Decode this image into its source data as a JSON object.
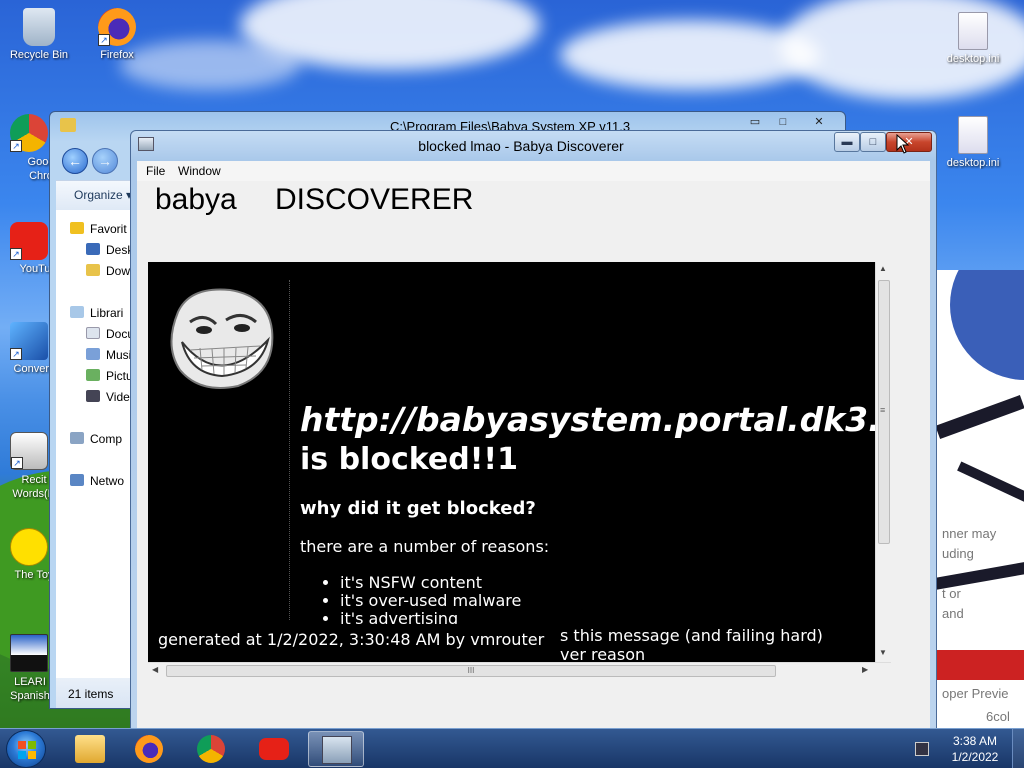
{
  "desktop": {
    "icons_left": [
      {
        "label": "Recycle Bin",
        "icon": "recycle-bin-icon"
      },
      {
        "label": "Firefox",
        "icon": "firefox-icon"
      },
      {
        "label": "Goog Chro",
        "icon": "chrome-icon"
      },
      {
        "label": "YouTu",
        "icon": "youtube-icon"
      },
      {
        "label": "Convers",
        "icon": "converter-icon"
      },
      {
        "label": "Recit Words(R",
        "icon": "recite-words-icon"
      },
      {
        "label": "The Toy",
        "icon": "smiley-icon"
      },
      {
        "label": "LEARI Spanish",
        "icon": "learn-spanish-icon"
      }
    ],
    "icons_right": [
      {
        "label": "desktop.ini",
        "icon": "ini-file-icon"
      },
      {
        "label": "desktop.ini",
        "icon": "ini-file-icon"
      }
    ],
    "faded_texts": [
      "nner may",
      "uding",
      "t or",
      "and",
      "oper Previe",
      "6col"
    ]
  },
  "explorer": {
    "title": "C:\\Program Files\\Babya System XP v11.3",
    "organize": "Organize ▾",
    "nav": [
      {
        "label": "Favorit",
        "icon": "star-icon"
      },
      {
        "label": "Desk",
        "icon": "desktop-folder-icon"
      },
      {
        "label": "Dow",
        "icon": "downloads-icon"
      },
      {
        "label": "Librari",
        "icon": "library-icon"
      },
      {
        "label": "Docu",
        "icon": "documents-icon"
      },
      {
        "label": "Musi",
        "icon": "music-icon"
      },
      {
        "label": "Pictu",
        "icon": "pictures-icon"
      },
      {
        "label": "Vide",
        "icon": "videos-icon"
      },
      {
        "label": "Comp",
        "icon": "computer-icon"
      },
      {
        "label": "Netwo",
        "icon": "network-icon"
      }
    ],
    "status": "21 items",
    "minimize": "▭",
    "maximize": "□",
    "close": "✕"
  },
  "discoverer": {
    "title": "blocked lmao - Babya Discoverer",
    "menu": {
      "file": "File",
      "window": "Window"
    },
    "brand_left": "babya",
    "brand_right": "DISCOVERER",
    "controls": {
      "minimize": "▬",
      "maximize": "□",
      "close": "✕"
    },
    "page": {
      "blocked_url": "http://babyasystem.portal.dk3.",
      "blocked_suffix": "is blocked!!1",
      "heading": "why did it get blocked?",
      "intro": "there are a number of reasons:",
      "reasons": [
        "it's NSFW content",
        "it's over-used malware",
        "it's advertising"
      ],
      "generated": "generated at 1/2/2022, 3:30:48 AM by vmrouter",
      "partial_line_1": "s this message (and failing hard)",
      "partial_line_2": "ver reason"
    },
    "hscroll_grip": "III",
    "vscroll_grip": "≡"
  },
  "taskbar": {
    "clock_time": "3:38 AM",
    "clock_date": "1/2/2022",
    "apps": [
      {
        "name": "explorer",
        "icon": "folder-icon"
      },
      {
        "name": "firefox",
        "icon": "firefox-icon"
      },
      {
        "name": "chrome",
        "icon": "chrome-icon"
      },
      {
        "name": "youtube",
        "icon": "youtube-icon"
      },
      {
        "name": "babya-discoverer",
        "icon": "network-computers-icon",
        "active": true
      }
    ]
  }
}
